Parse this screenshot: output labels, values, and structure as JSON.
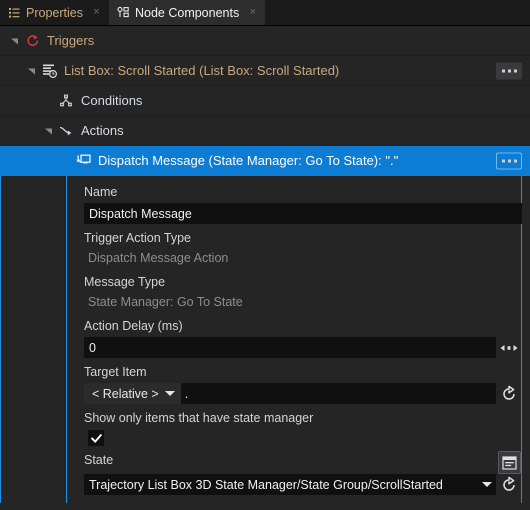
{
  "tabs": [
    {
      "label": "Properties",
      "icon": "list-icon",
      "active": false,
      "close": "×"
    },
    {
      "label": "Node Components",
      "icon": "node-components-icon",
      "active": true,
      "close": "×"
    }
  ],
  "tree": [
    {
      "label": "Triggers",
      "icon": "trigger-circle-icon",
      "depth": 0,
      "expanded": true,
      "selected": false,
      "overflow": false,
      "pale": false
    },
    {
      "label": "List Box: Scroll Started (List Box: Scroll Started)",
      "icon": "event-list-icon",
      "depth": 1,
      "expanded": true,
      "selected": false,
      "overflow": true,
      "pale": false
    },
    {
      "label": "Conditions",
      "icon": "conditions-node-icon",
      "depth": 2,
      "expanded": false,
      "selected": false,
      "overflow": false,
      "pale": true
    },
    {
      "label": "Actions",
      "icon": "actions-arrow-icon",
      "depth": 2,
      "expanded": true,
      "selected": false,
      "overflow": false,
      "pale": true
    },
    {
      "label": "Dispatch Message (State Manager: Go To State): \".\"",
      "icon": "dispatch-message-icon",
      "depth": 3,
      "expanded": false,
      "selected": true,
      "overflow": true,
      "pale": false
    }
  ],
  "form": {
    "name": {
      "label": "Name",
      "value": "Dispatch Message"
    },
    "trigger_action_type": {
      "label": "Trigger Action Type",
      "value": "Dispatch Message Action"
    },
    "message_type": {
      "label": "Message Type",
      "value": "State Manager: Go To State"
    },
    "action_delay": {
      "label": "Action Delay (ms)",
      "value": "0",
      "drag_icon": "horizontal-drag-icon"
    },
    "target_item": {
      "label": "Target Item",
      "mode": "< Relative >",
      "path": ".",
      "reset_icon": "reset-arrow-icon"
    },
    "show_only_state_manager": {
      "label": "Show only items that have state manager",
      "checked": true,
      "check_glyph": "✔"
    },
    "state": {
      "label": "State",
      "value": "Trajectory List Box 3D State Manager/State Group/ScrollStarted",
      "picker_icon": "panel-window-icon",
      "reset_icon": "reset-arrow-icon"
    }
  },
  "colors": {
    "accent_blue": "#0c7cd5",
    "guide_blue": "#1b8fe3",
    "tab_text_inactive": "#c8a97e",
    "tree_text": "#c8a97e",
    "tree_text_pale": "#d6dde3",
    "panel_bg": "#252526",
    "input_bg": "#101010",
    "trigger_icon_red": "#d63a3a"
  }
}
